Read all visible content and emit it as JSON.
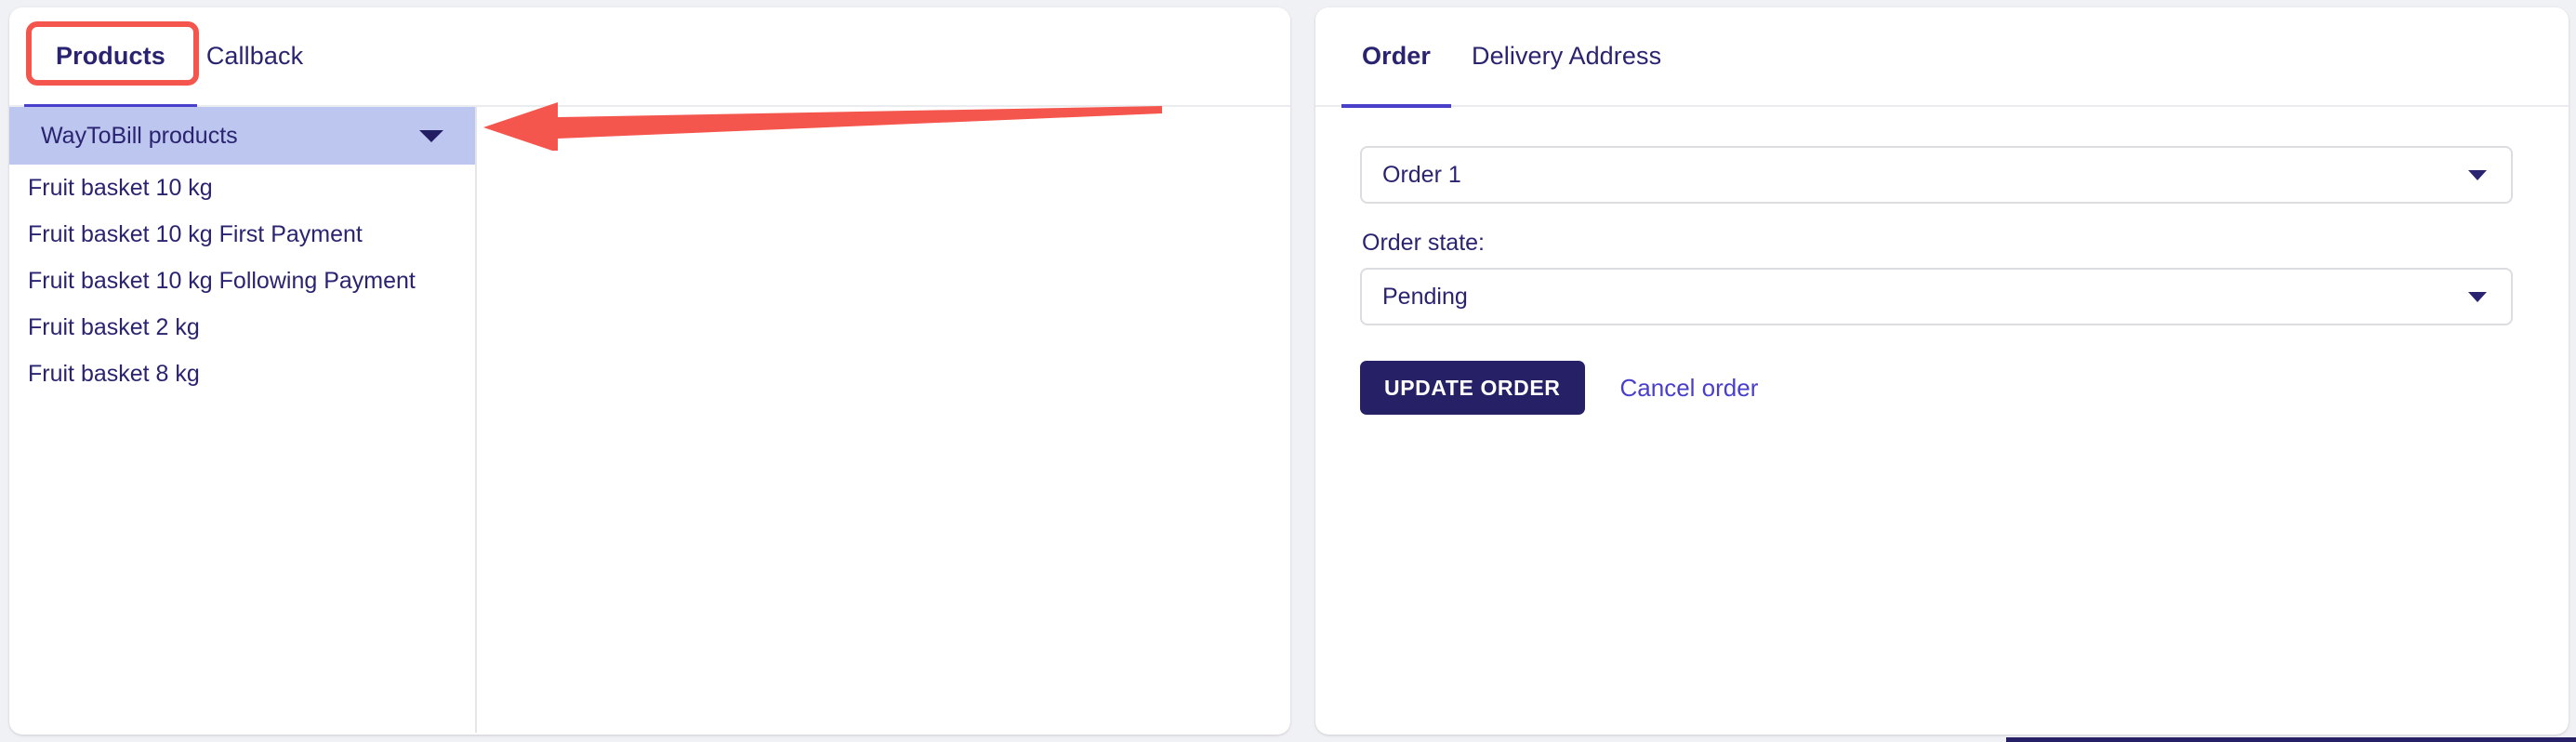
{
  "theme": {
    "page_background": "#f0f1f4",
    "card_background": "#ffffff",
    "accent": "#4a3fcb",
    "primary_dark": "#262166",
    "text": "#2a2470",
    "annotation_red": "#f4564d",
    "selected_row": "#bcc6ef"
  },
  "products_panel": {
    "tabs": [
      {
        "label": "Products",
        "active": true,
        "highlighted": true
      },
      {
        "label": "Callback",
        "active": false,
        "highlighted": false
      }
    ],
    "group": {
      "label": "WayToBill products",
      "expanded": true,
      "caret_icon": "chevron-down-icon"
    },
    "items": [
      {
        "label": "Fruit basket 10 kg"
      },
      {
        "label": "Fruit basket 10 kg First Payment"
      },
      {
        "label": "Fruit basket 10 kg Following Payment"
      },
      {
        "label": "Fruit basket 2 kg"
      },
      {
        "label": "Fruit basket 8 kg"
      }
    ]
  },
  "order_panel": {
    "tabs": [
      {
        "label": "Order",
        "active": true
      },
      {
        "label": "Delivery Address",
        "active": false
      }
    ],
    "order_select": {
      "value": "Order 1",
      "caret_icon": "chevron-down-icon"
    },
    "order_state": {
      "label": "Order state:",
      "value": "Pending",
      "caret_icon": "chevron-down-icon"
    },
    "actions": {
      "update_label": "UPDATE ORDER",
      "cancel_label": "Cancel order"
    }
  },
  "annotation": {
    "arrow_direction": "left",
    "arrow_color": "#f4564d",
    "highlight_target": "Products"
  }
}
